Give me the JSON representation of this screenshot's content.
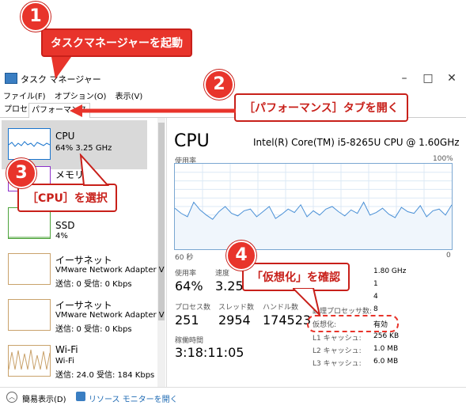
{
  "window": {
    "title": "タスク マネージャー"
  },
  "menu": [
    "ファイル(F)",
    "オプション(O)",
    "表示(V)"
  ],
  "tabs": {
    "processes": "プロセス",
    "performance": "パフォーマンス"
  },
  "sidebar": {
    "cpu": {
      "title": "CPU",
      "sub": "64%  3.25 GHz"
    },
    "memory": {
      "title": "メモリ"
    },
    "ssd": {
      "title": "SSD",
      "sub": "4%"
    },
    "ethernet1": {
      "title": "イーサネット",
      "sub1": "VMware Network Adapter V",
      "sub2": "送信: 0  受信: 0 Kbps"
    },
    "ethernet2": {
      "title": "イーサネット",
      "sub1": "VMware Network Adapter V",
      "sub2": "送信: 0  受信: 0 Kbps"
    },
    "wifi": {
      "title": "Wi-Fi",
      "sub1": "Wi-Fi",
      "sub2": "送信: 24.0  受信: 184 Kbps"
    }
  },
  "main": {
    "title": "CPU",
    "cpu_name": "Intel(R) Core(TM) i5-8265U CPU @ 1.60GHz",
    "usage_label": "使用率",
    "max_label": "100%",
    "time_left": "60 秒",
    "time_right": "0",
    "stats": {
      "usage_l": "使用率",
      "usage_v": "64%",
      "speed_l": "速度",
      "speed_v": "3.25",
      "proc_l": "プロセス数",
      "proc_v": "251",
      "thread_l": "スレッド数",
      "thread_v": "2954",
      "handle_l": "ハンドル数",
      "handle_v": "174523",
      "uptime_l": "稼働時間",
      "uptime_v": "3:18:11:05"
    },
    "specs": [
      {
        "l": "",
        "v": "1.80 GHz"
      },
      {
        "l": "",
        "v": "1"
      },
      {
        "l": "",
        "v": "4"
      },
      {
        "l": "論理プロセッサ数:",
        "v": "8"
      },
      {
        "l": "仮想化:",
        "v": "有効"
      },
      {
        "l": "L1 キャッシュ:",
        "v": "256 KB"
      },
      {
        "l": "L2 キャッシュ:",
        "v": "1.0 MB"
      },
      {
        "l": "L3 キャッシュ:",
        "v": "6.0 MB"
      }
    ]
  },
  "bottom": {
    "compact": "簡易表示(D)",
    "monitor": "リソース モニターを開く"
  },
  "annotations": {
    "a1": {
      "num": "1",
      "text": "タスクマネージャーを起動"
    },
    "a2": {
      "num": "2",
      "text": "［パフォーマンス］タブを開く"
    },
    "a3": {
      "num": "3",
      "text": "［CPU］を選択"
    },
    "a4": {
      "num": "4",
      "text": "「仮想化」を確認"
    }
  },
  "graph_series": [
    48,
    42,
    38,
    55,
    46,
    40,
    35,
    44,
    50,
    42,
    39,
    45,
    47,
    38,
    44,
    50,
    36,
    41,
    47,
    43,
    52,
    38,
    45,
    40,
    47,
    50,
    44,
    39,
    46,
    42,
    55,
    40,
    43,
    48,
    41,
    37,
    49,
    44,
    42,
    51,
    38,
    45,
    47,
    40,
    52
  ]
}
